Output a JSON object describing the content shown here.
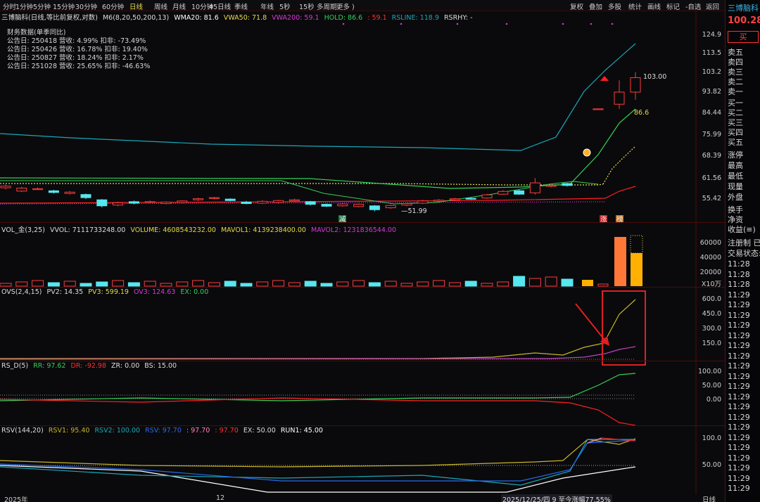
{
  "toolbar": {
    "periods": [
      "分时",
      "1分钟",
      "5分钟",
      "15分钟",
      "30分钟",
      "60分钟",
      "日线",
      "周线",
      "月线",
      "10分钟",
      "45日线",
      "季线",
      "年线",
      "5秒",
      "15秒",
      "多周期",
      "更多 )"
    ],
    "right": [
      "复权",
      "叠加",
      "多股",
      "统计",
      "画线",
      "标记",
      "-自选",
      "返回"
    ]
  },
  "quote": {
    "name": "三博脑科",
    "price": "100.28",
    "buy": "买",
    "levels": [
      "卖五",
      "卖四",
      "卖三",
      "卖二",
      "卖一",
      "买一",
      "买二",
      "买三",
      "买四",
      "买五",
      "涨停",
      "最高",
      "最低",
      "现量",
      "外盘",
      "换手",
      "净资",
      "收益(≡)",
      "注册制 已",
      "交易状态:"
    ],
    "times": [
      "11:28",
      "11:28",
      "11:28",
      "11:29",
      "11:29",
      "11:29",
      "11:29",
      "11:29",
      "11:29",
      "11:29",
      "11:29",
      "11:29",
      "11:29",
      "11:29",
      "11:29",
      "11:29",
      "11:29",
      "11:29",
      "11:29",
      "11:29",
      "11:29",
      "11:29",
      "11:29"
    ]
  },
  "main": {
    "title": "三博脑科(日线,等比前复权,对数)",
    "m6": "M6(8,20,50,200,13)",
    "wma20": "WMA20: 81.6",
    "vwa50": "VWA50: 71.8",
    "vwa200": "VWA200: 59.1",
    "hold": "HOLD: 86.6",
    "hold2": ": 59.1",
    "rsline": "RSLINE: 118.9",
    "rsrhy": "RSRHY: -",
    "fin_title": "财务数据(单季同比)",
    "fin": [
      "公告日: 250418  营收:  4.99%  扣非: -73.49%",
      "公告日: 250426  营收: 16.78%  扣非: 19.40%",
      "公告日: 250827  营收: 18.24%  扣非:  2.17%",
      "公告日: 251028  营收: 25.65%  扣非: -46.63%"
    ],
    "ticks": [
      "124.9",
      "113.5",
      "103.2",
      "93.82",
      "84.44",
      "75.99",
      "68.39",
      "61.56",
      "55.42"
    ],
    "high_label": "103.00",
    "low_label": "51.99",
    "hold_label": "86.6",
    "tag_jian": "减",
    "tag_zhang": "涨",
    "tag_bang": "榜"
  },
  "vol": {
    "title": "VOL_金(3,25)",
    "vvol": "VVOL: 7111733248.00",
    "volume": "VOLUME: 4608543232.00",
    "mavol1": "MAVOL1: 4139238400.00",
    "mavol2": "MAVOL2: 1231836544.00",
    "ticks": [
      "60000",
      "40000",
      "20000"
    ],
    "unit": "X10万"
  },
  "ovs": {
    "title": "OVS(2,4,15)",
    "pv2": "PV2: 14.35",
    "pv3": "PV3: 599.19",
    "ov3": "OV3: 124.63",
    "ex": "EX: 0.00",
    "ticks": [
      "600.0",
      "450.0",
      "300.0",
      "150.0"
    ]
  },
  "rsd": {
    "title": "RS_D(5)",
    "rr": "RR: 97.62",
    "dr": "DR: -92.98",
    "zr": "ZR: 0.00",
    "bs": "BS: 15.00",
    "ticks": [
      "100.00",
      "50.00",
      "0.00"
    ]
  },
  "rsv": {
    "title": "RSV(144,20)",
    "rsv1": "RSV1: 95.40",
    "rsv2": "RSV2: 100.00",
    "rsv": "RSV: 97.70",
    "v2": ": 97.70",
    "v3": ": 97.70",
    "ex": "EX: 50.00",
    "run1": "RUN1: 45.00",
    "ticks": [
      "100.0",
      "50.00"
    ]
  },
  "bottom": {
    "year": "2025年",
    "month": "12",
    "range": "2025/12/25/四 9 至今涨幅77.55%",
    "period": "日线"
  },
  "colors": {
    "up": "#ff3b3b",
    "down": "#54e8f0",
    "wma": "#ffffff",
    "vwa50": "#e8d84a",
    "vwa200": "#d43ad4",
    "hold": "#34d058",
    "red": "#ff2020",
    "rsline": "#1aa7b8",
    "accent": "#e8d84a"
  }
}
